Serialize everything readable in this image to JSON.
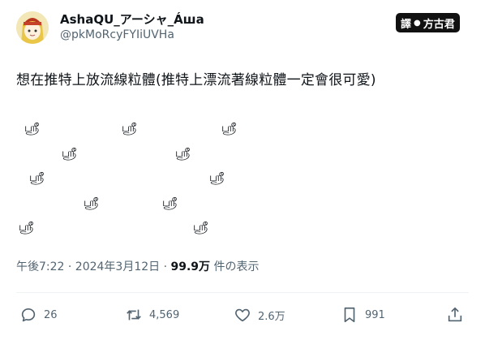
{
  "author": {
    "display_name": "AshaQU_アーシャ_Áшa",
    "handle": "@pkMoRcyFYIiUVHa",
    "avatar_icon": "anime-avatar-icon"
  },
  "watermark": {
    "left": "譯",
    "dot": "●",
    "right": "方古君"
  },
  "tweet": {
    "text": "想在推特上放流線粒體(推特上漂流著線粒體一定會很可愛)",
    "glyphs": [
      "ஸ்ரீ",
      "ஸ்ரீ",
      "ஸ்ரீ",
      "ஸ்ரீ",
      "ஸ்ரீ",
      "ஸ்ரீ",
      "ஸ்ரீ",
      "ஸ்ரீ",
      "ஸ்ரீ",
      "ஸ்ரீ",
      "ஸ்ரீ"
    ]
  },
  "meta": {
    "timestamp": "午後7:22 · 2024年3月12日 · ",
    "views": "99.9万",
    "views_label": " 件の表示"
  },
  "actions": {
    "replies": "26",
    "reposts": "4,569",
    "likes": "2.6万",
    "bookmarks": "991"
  }
}
